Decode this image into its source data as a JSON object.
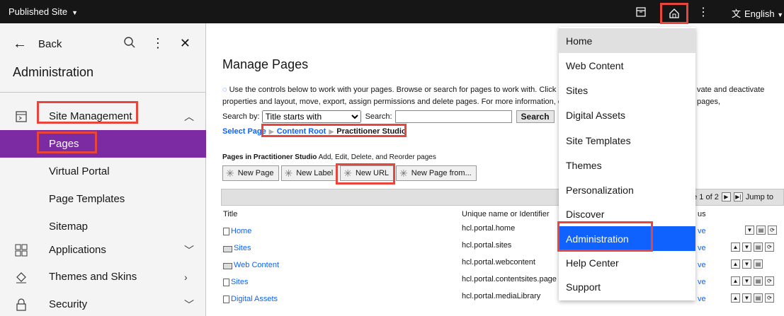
{
  "topbar": {
    "site_label": "Published Site",
    "language": "English"
  },
  "sidebar": {
    "back": "Back",
    "title": "Administration",
    "items": [
      {
        "label": "Site Management"
      },
      {
        "label": "Pages"
      },
      {
        "label": "Virtual Portal"
      },
      {
        "label": "Page Templates"
      },
      {
        "label": "Sitemap"
      },
      {
        "label": "Applications"
      },
      {
        "label": "Themes and Skins"
      },
      {
        "label": "Security"
      }
    ]
  },
  "main": {
    "title": "Manage Pages",
    "intro_line1": "Use the controls below to work with your pages. Browse or search for pages to work with. Click New",
    "intro_line1_end": "vate and deactivate pages,",
    "intro_line2": "properties and layout, move, export, assign permissions and delete pages. For more information, click H",
    "search_by_label": "Search by:",
    "search_by_value": "Title starts with",
    "search_label": "Search:",
    "search_value": "",
    "search_button": "Search",
    "breadcrumb": [
      "Select Page",
      "Content Root",
      "Practitioner Studio"
    ],
    "pages_in_prefix": "Pages in",
    "pages_in_name": "Practitioner Studio",
    "pages_in_suffix": "Add, Edit, Delete, and Reorder pages",
    "buttons": [
      "New Page",
      "New Label",
      "New URL",
      "New Page from..."
    ],
    "pager_text": "ge 1 of 2",
    "jump_to": "Jump to",
    "columns": {
      "title": "Title",
      "unique": "Unique name or Identifier",
      "status": "us"
    },
    "rows": [
      {
        "title": "Home",
        "unique": "hcl.portal.home",
        "status": "ve",
        "icon": "page"
      },
      {
        "title": "Sites",
        "unique": "hcl.portal.sites",
        "status": "ve",
        "icon": "label"
      },
      {
        "title": "Web Content",
        "unique": "hcl.portal.webcontent",
        "status": "ve",
        "icon": "label"
      },
      {
        "title": "Sites",
        "unique": "hcl.portal.contentsites.page",
        "status": "ve",
        "icon": "page"
      },
      {
        "title": "Digital Assets",
        "unique": "hcl.portal.mediaLibrary",
        "status": "ve",
        "icon": "page"
      }
    ]
  },
  "menu": {
    "items": [
      "Home",
      "Web Content",
      "Sites",
      "Digital Assets",
      "Site Templates",
      "Themes",
      "Personalization",
      "Discover",
      "Administration",
      "Help Center",
      "Support"
    ]
  },
  "colors": {
    "accent_purple": "#7c2ba3",
    "accent_blue": "#0f62fe",
    "highlight_red": "#e8453c"
  }
}
